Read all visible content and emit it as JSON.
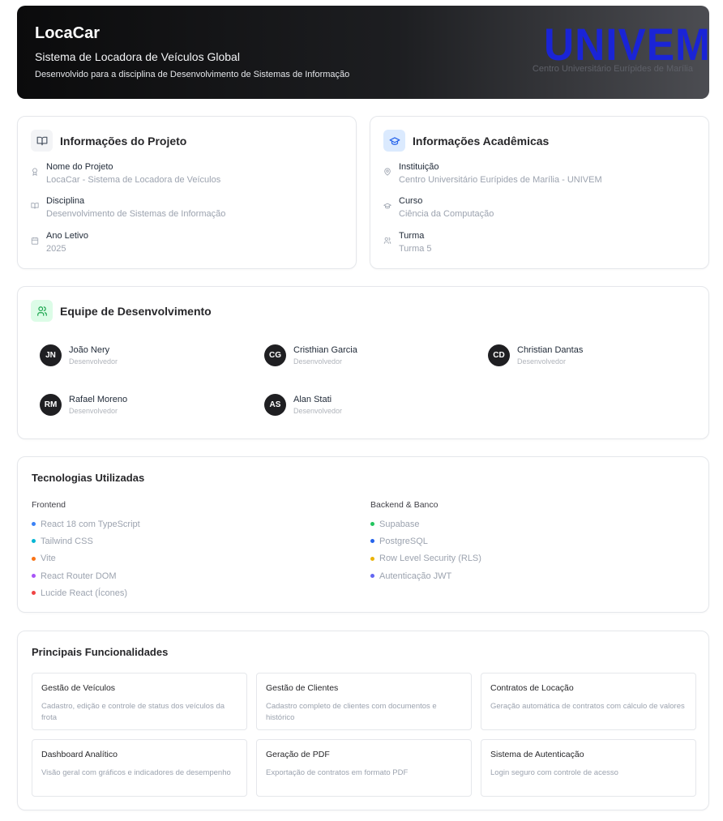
{
  "header": {
    "title": "LocaCar",
    "subtitle": "Sistema de Locadora de Veículos Global",
    "description": "Desenvolvido para a disciplina de Desenvolvimento de Sistemas de Informação",
    "logo_word": "UNIVEM",
    "logo_tagline": "Centro Universitário Eurípides de Marília"
  },
  "project_info": {
    "title": "Informações do Projeto",
    "icon": "book-open-icon",
    "rows": [
      {
        "label": "Nome do Projeto",
        "value": "LocaCar - Sistema de Locadora de Veículos",
        "icon": "award-icon"
      },
      {
        "label": "Disciplina",
        "value": "Desenvolvimento de Sistemas de Informação",
        "icon": "book-icon"
      },
      {
        "label": "Ano Letivo",
        "value": "2025",
        "icon": "calendar-icon"
      }
    ]
  },
  "academic_info": {
    "title": "Informações Acadêmicas",
    "icon": "graduation-cap-icon",
    "rows": [
      {
        "label": "Instituição",
        "value": "Centro Universitário Eurípides de Marília - UNIVEM",
        "icon": "map-pin-icon"
      },
      {
        "label": "Curso",
        "value": "Ciência da Computação",
        "icon": "graduation-cap-icon"
      },
      {
        "label": "Turma",
        "value": "Turma 5",
        "icon": "users-icon"
      }
    ]
  },
  "team": {
    "title": "Equipe de Desenvolvimento",
    "icon": "users-icon",
    "members": [
      {
        "initials": "JN",
        "name": "João Nery",
        "role": "Desenvolvedor"
      },
      {
        "initials": "CG",
        "name": "Cristhian Garcia",
        "role": "Desenvolvedor"
      },
      {
        "initials": "CD",
        "name": "Christian Dantas",
        "role": "Desenvolvedor"
      },
      {
        "initials": "RM",
        "name": "Rafael Moreno",
        "role": "Desenvolvedor"
      },
      {
        "initials": "AS",
        "name": "Alan Stati",
        "role": "Desenvolvedor"
      }
    ]
  },
  "tech": {
    "title": "Tecnologias Utilizadas",
    "frontend": {
      "title": "Frontend",
      "items": [
        {
          "label": "React 18 com TypeScript",
          "color": "#3b82f6"
        },
        {
          "label": "Tailwind CSS",
          "color": "#06b6d4"
        },
        {
          "label": "Vite",
          "color": "#f97316"
        },
        {
          "label": "React Router DOM",
          "color": "#a855f7"
        },
        {
          "label": "Lucide React (Ícones)",
          "color": "#ef4444"
        }
      ]
    },
    "backend": {
      "title": "Backend & Banco",
      "items": [
        {
          "label": "Supabase",
          "color": "#22c55e"
        },
        {
          "label": "PostgreSQL",
          "color": "#2563eb"
        },
        {
          "label": "Row Level Security (RLS)",
          "color": "#eab308"
        },
        {
          "label": "Autenticação JWT",
          "color": "#6366f1"
        }
      ]
    }
  },
  "features": {
    "title": "Principais Funcionalidades",
    "items": [
      {
        "title": "Gestão de Veículos",
        "desc": "Cadastro, edição e controle de status dos veículos da frota"
      },
      {
        "title": "Gestão de Clientes",
        "desc": "Cadastro completo de clientes com documentos e histórico"
      },
      {
        "title": "Contratos de Locação",
        "desc": "Geração automática de contratos com cálculo de valores"
      },
      {
        "title": "Dashboard Analítico",
        "desc": "Visão geral com gráficos e indicadores de desempenho"
      },
      {
        "title": "Geração de PDF",
        "desc": "Exportação de contratos em formato PDF"
      },
      {
        "title": "Sistema de Autenticação",
        "desc": "Login seguro com controle de acesso"
      }
    ]
  }
}
